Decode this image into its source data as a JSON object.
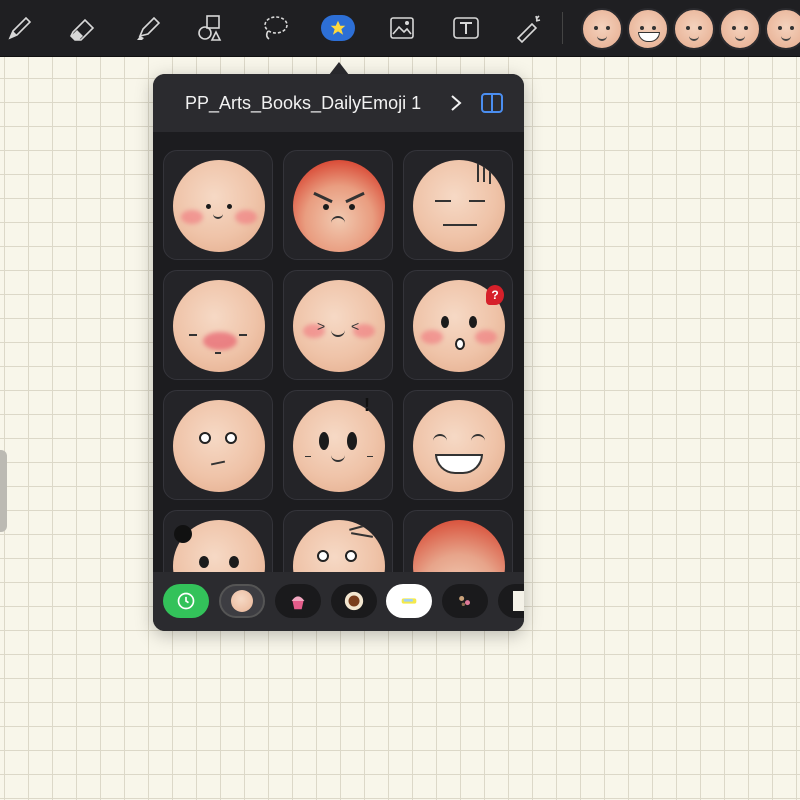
{
  "toolbar": {
    "tools": [
      {
        "name": "pen-icon"
      },
      {
        "name": "eraser-icon"
      },
      {
        "name": "highlighter-icon"
      },
      {
        "name": "shapes-icon"
      },
      {
        "name": "lasso-icon"
      },
      {
        "name": "favorites-star-icon",
        "active": true
      },
      {
        "name": "image-icon"
      },
      {
        "name": "text-box-icon"
      },
      {
        "name": "laser-pointer-icon"
      }
    ],
    "accent_color": "#2d6fd6",
    "favorite_stickers": [
      "sticker-wink-face",
      "sticker-grin-face",
      "sticker-pout-face",
      "sticker-calm-face",
      "sticker-blush-face"
    ]
  },
  "popover": {
    "title": "PP_Arts_Books_DailyEmoji 1",
    "chevron": "›",
    "header_bg": "#2b2b2f",
    "stickers": [
      {
        "name": "sticker-smile-blush"
      },
      {
        "name": "sticker-angry-red"
      },
      {
        "name": "sticker-gloomy"
      },
      {
        "name": "sticker-shy-blush"
      },
      {
        "name": "sticker-squint-blush"
      },
      {
        "name": "sticker-surprised-question"
      },
      {
        "name": "sticker-thinking-up"
      },
      {
        "name": "sticker-exclaim"
      },
      {
        "name": "sticker-big-grin"
      },
      {
        "name": "sticker-dizzy"
      },
      {
        "name": "sticker-confused-lines"
      },
      {
        "name": "sticker-red-top"
      }
    ],
    "question_mark": "?",
    "exclamation": "!"
  },
  "sticker_tabs": [
    {
      "name": "recent-tab",
      "icon": "clock-icon",
      "color": "#33c25a"
    },
    {
      "name": "daily-emoji-tab",
      "selected": true
    },
    {
      "name": "cupcake-tab"
    },
    {
      "name": "cookie-tab"
    },
    {
      "name": "highlight-tab"
    },
    {
      "name": "sparkle-tab"
    },
    {
      "name": "paper-tab"
    }
  ]
}
